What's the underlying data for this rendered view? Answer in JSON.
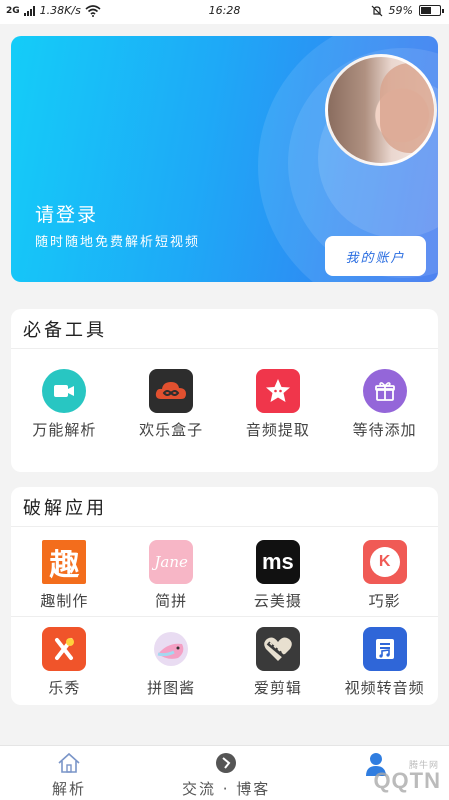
{
  "statusbar": {
    "signal": "2G",
    "net_speed": "1.38K/s",
    "time": "16:28",
    "battery": "59%",
    "battery_level": 0.59
  },
  "hero": {
    "title": "请登录",
    "subtitle": "随时随地免费解析短视频",
    "account_button": "我的账户"
  },
  "tools": {
    "title": "必备工具",
    "items": [
      {
        "label": "万能解析",
        "icon": "video-camera-icon",
        "color": "#28c6c2"
      },
      {
        "label": "欢乐盒子",
        "icon": "cloud-infinity-icon",
        "color": "#e1502f"
      },
      {
        "label": "音频提取",
        "icon": "star-face-icon",
        "color": "#f0364b"
      },
      {
        "label": "等待添加",
        "icon": "gift-icon",
        "color": "#9466d9"
      }
    ]
  },
  "apps": {
    "title": "破解应用",
    "rows": [
      [
        {
          "label": "趣制作",
          "icon": "qu-icon",
          "glyph": "趣",
          "color": "#f36d1c"
        },
        {
          "label": "简拼",
          "icon": "jane-icon",
          "glyph": "Jane",
          "color": "#f7b6c6"
        },
        {
          "label": "云美摄",
          "icon": "ms-icon",
          "glyph": "ms",
          "color": "#111111"
        },
        {
          "label": "巧影",
          "icon": "kinemaster-icon",
          "glyph": "K",
          "color": "#f05a55"
        }
      ],
      [
        {
          "label": "乐秀",
          "icon": "lexiu-icon",
          "glyph": "✂",
          "color": "#f0542a"
        },
        {
          "label": "拼图酱",
          "icon": "bird-icon",
          "glyph": "",
          "color": "#e6d8f0"
        },
        {
          "label": "爱剪辑",
          "icon": "heart-film-icon",
          "glyph": "♥",
          "color": "#3a3a3a"
        },
        {
          "label": "视频转音频",
          "icon": "music-convert-icon",
          "glyph": "♪",
          "color": "#2f66d8"
        }
      ]
    ]
  },
  "bottombar": {
    "tabs": [
      {
        "label": "解析",
        "icon": "home-icon"
      },
      {
        "label": "交流 · 博客",
        "icon": "compass-icon"
      },
      {
        "label": "",
        "icon": "user-icon"
      }
    ],
    "watermark": "QQTN",
    "watermark_small": "腾牛网"
  }
}
